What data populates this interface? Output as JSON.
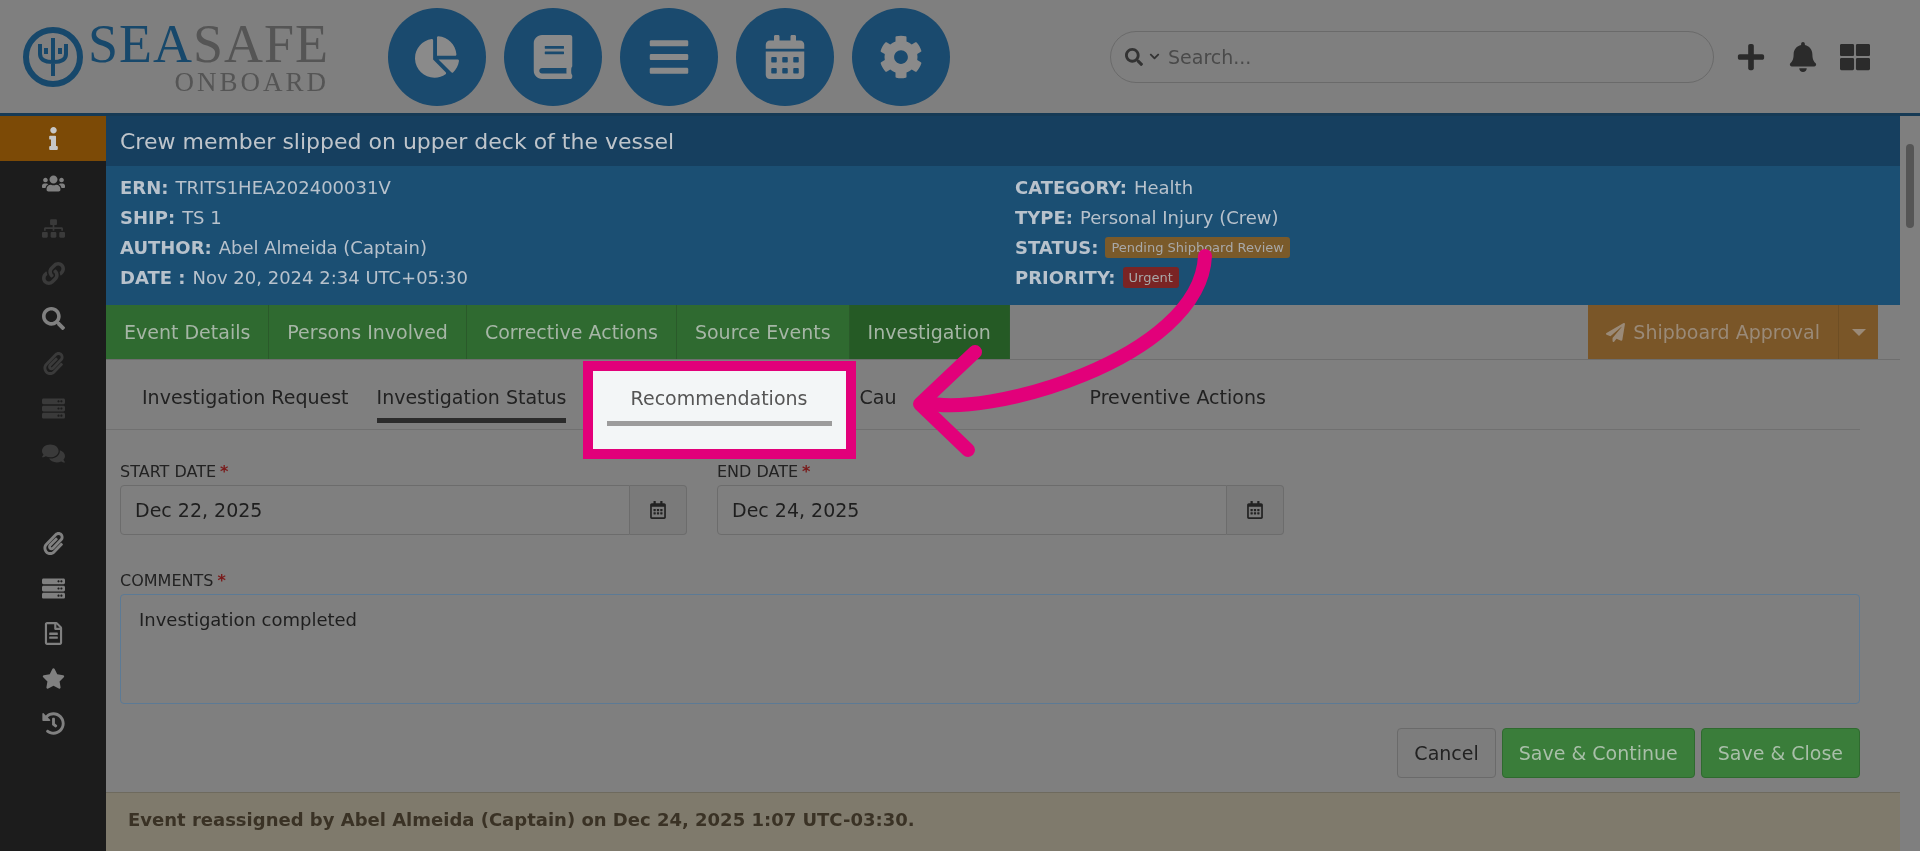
{
  "logo": {
    "word_1": "SEA",
    "word_2": "SAFE",
    "tagline": "ONBOARD"
  },
  "search": {
    "placeholder": "Search..."
  },
  "sidebar": {
    "items": [
      {
        "kind": "info",
        "selected": true,
        "disabled": false
      },
      {
        "kind": "users",
        "selected": false,
        "disabled": false
      },
      {
        "kind": "sitemap",
        "selected": false,
        "disabled": true
      },
      {
        "kind": "link",
        "selected": false,
        "disabled": true
      },
      {
        "kind": "search",
        "selected": false,
        "disabled": false
      },
      {
        "kind": "paperclip",
        "selected": false,
        "disabled": true
      },
      {
        "kind": "server",
        "selected": false,
        "disabled": true
      },
      {
        "kind": "comments",
        "selected": false,
        "disabled": true
      },
      {
        "kind": "gap"
      },
      {
        "kind": "paperclip",
        "selected": false,
        "disabled": false
      },
      {
        "kind": "server",
        "selected": false,
        "disabled": false
      },
      {
        "kind": "file",
        "selected": false,
        "disabled": false
      },
      {
        "kind": "star",
        "selected": false,
        "disabled": false
      },
      {
        "kind": "history",
        "selected": false,
        "disabled": false
      }
    ]
  },
  "event": {
    "title": "Crew member slipped on upper deck of the vessel",
    "left": [
      {
        "label": "ERN:",
        "value": "TRITS1HEA202400031V"
      },
      {
        "label": "SHIP:",
        "value": "TS 1"
      },
      {
        "label": "AUTHOR:",
        "value": "Abel Almeida (Captain)"
      },
      {
        "label": "DATE :",
        "value": "Nov 20, 2024 2:34 UTC+05:30"
      }
    ],
    "right": [
      {
        "label": "CATEGORY:",
        "value": "Health"
      },
      {
        "label": "TYPE:",
        "value": "Personal Injury (Crew)"
      },
      {
        "label": "STATUS:",
        "badge": "Pending Shipboard Review",
        "color": "#7a5a2a"
      },
      {
        "label": "PRIORITY:",
        "badge": "Urgent",
        "color": "#7a2424"
      }
    ]
  },
  "tabs": [
    {
      "label": "Event Details",
      "selected": false
    },
    {
      "label": "Persons Involved",
      "selected": false
    },
    {
      "label": "Corrective Actions",
      "selected": false
    },
    {
      "label": "Source Events",
      "selected": false
    },
    {
      "label": "Investigation",
      "selected": true
    }
  ],
  "approval_button": {
    "label": "Shipboard Approval"
  },
  "subtabs": [
    {
      "label": "Investigation Request",
      "selected": false,
      "spotlight": false
    },
    {
      "label": "Investigation Status",
      "selected": true,
      "spotlight": false
    },
    {
      "label": "Recommendations",
      "selected": false,
      "spotlight": true
    },
    {
      "label": "Cau",
      "selected": false,
      "spotlight": false
    },
    {
      "label": "Preventive Actions",
      "selected": false,
      "spotlight": false
    }
  ],
  "start_date": {
    "label": "START DATE",
    "required_mark": "*",
    "value": "Dec 22, 2025"
  },
  "end_date": {
    "label": "END DATE",
    "required_mark": "*",
    "value": "Dec 24, 2025"
  },
  "comments": {
    "label": "COMMENTS",
    "required_mark": "*",
    "value": "Investigation completed"
  },
  "buttons": [
    {
      "label": "Cancel",
      "kind": "default"
    },
    {
      "label": "Save & Continue",
      "kind": "primary"
    },
    {
      "label": "Save & Close",
      "kind": "primary"
    }
  ],
  "banner": {
    "text": "Event reassigned by Abel Almeida (Captain) on Dec 24, 2025 1:07 UTC-03:30."
  }
}
